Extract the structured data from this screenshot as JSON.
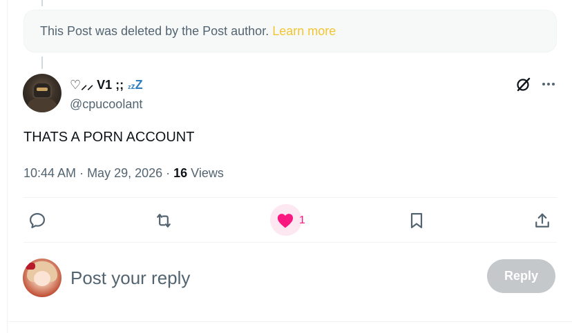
{
  "deleted_notice": {
    "text": "This Post was deleted by the Post author.",
    "link": "Learn more"
  },
  "post": {
    "display_name": "♡⸝⸝ V1 ;;",
    "name_decoration": "z z Z",
    "handle": "@cpucoolant",
    "text": "THATS A PORN ACCOUNT",
    "time": "10:44 AM",
    "separator": "·",
    "date": "May 29, 2026",
    "views_count": "16",
    "views_label": "Views"
  },
  "actions": {
    "likes": "1",
    "like_color": "#f91880",
    "icons": [
      "reply-icon",
      "repost-icon",
      "heart-icon",
      "bookmark-icon",
      "share-icon"
    ]
  },
  "reply_box": {
    "placeholder": "Post your reply",
    "button": "Reply"
  }
}
